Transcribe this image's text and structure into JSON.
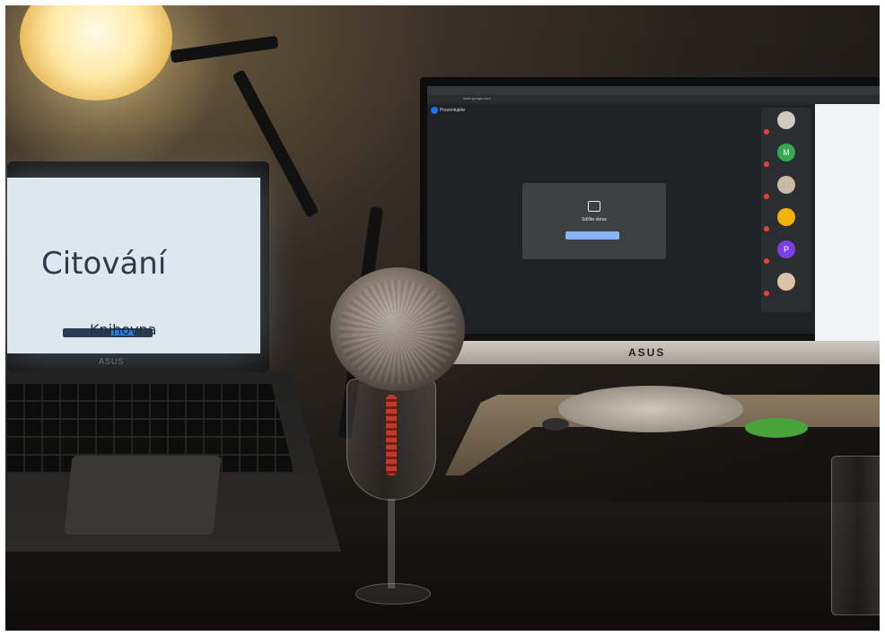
{
  "laptop": {
    "slide_title": "Citování",
    "slide_brand": "Knihovna",
    "brand": "ASUS"
  },
  "monitor": {
    "brand": "ASUS",
    "meet": {
      "title": "Prezentujete",
      "url": "meet.google.com",
      "share_label": "Sdílíte obraz",
      "participant_initials": [
        "",
        "M",
        "",
        "",
        "P",
        ""
      ]
    }
  }
}
